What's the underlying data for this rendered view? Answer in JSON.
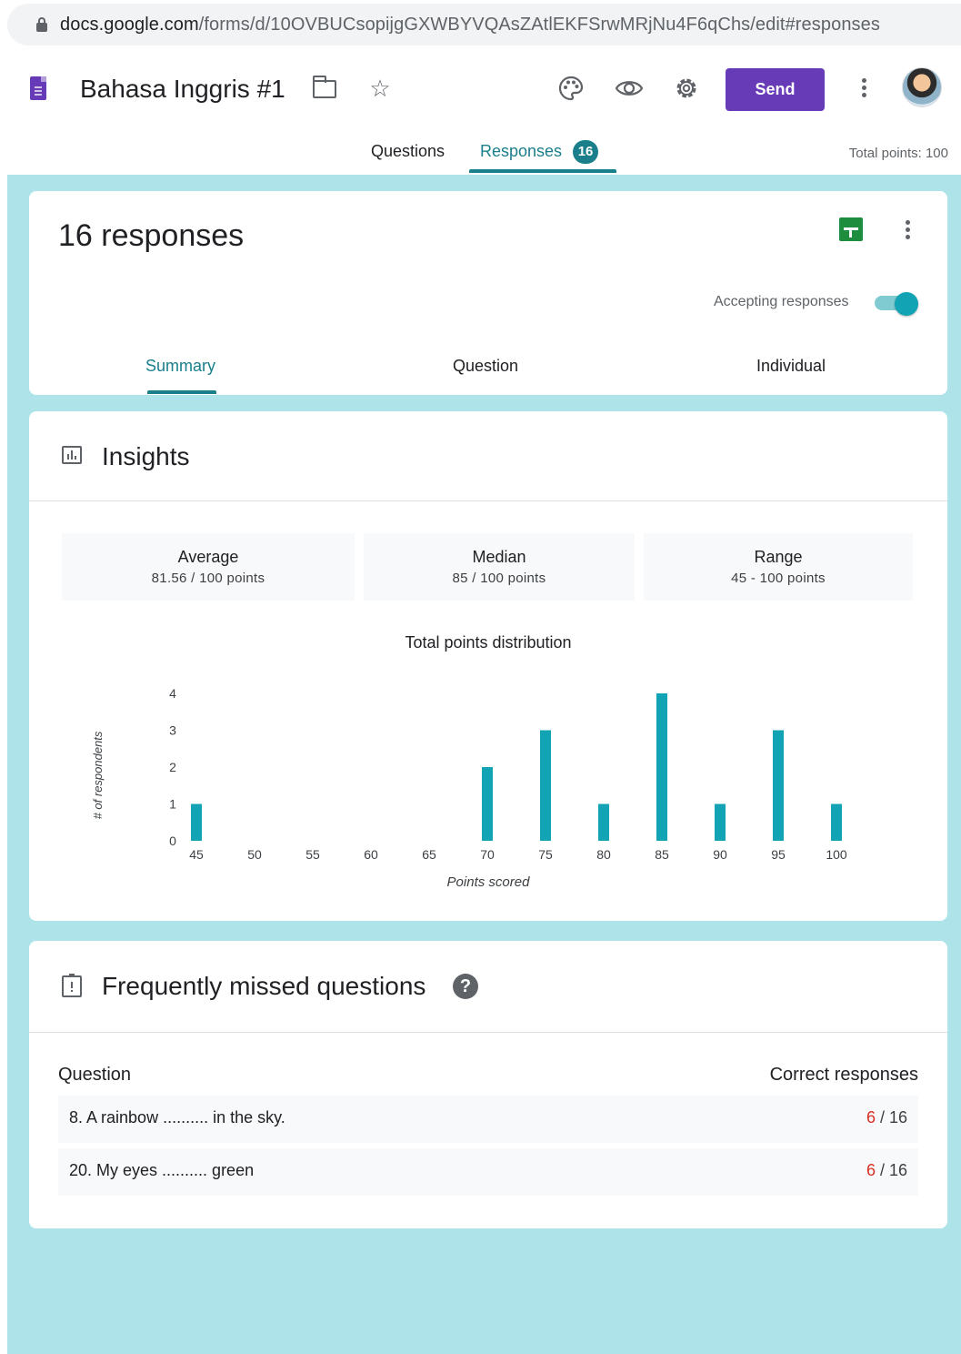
{
  "browser": {
    "url_host": "docs.google.com",
    "url_path": "/forms/d/10OVBUCsopijgGXWBYVQAsZAtlEKFSrwMRjNu4F6qChs/edit#responses"
  },
  "header": {
    "title": "Bahasa Inggris #1",
    "send_label": "Send",
    "tabs": [
      {
        "label": "Questions"
      },
      {
        "label": "Responses",
        "badge": "16"
      }
    ],
    "total_points": "Total points: 100"
  },
  "responses_card": {
    "count_label": "16 responses",
    "accepting_label": "Accepting responses",
    "accepting": true,
    "subtabs": [
      {
        "label": "Summary"
      },
      {
        "label": "Question"
      },
      {
        "label": "Individual"
      }
    ]
  },
  "insights": {
    "title": "Insights",
    "stats": [
      {
        "label": "Average",
        "value": "81.56 / 100 points"
      },
      {
        "label": "Median",
        "value": "85 / 100 points"
      },
      {
        "label": "Range",
        "value": "45 - 100 points"
      }
    ]
  },
  "chart_data": {
    "type": "bar",
    "title": "Total points distribution",
    "xlabel": "Points scored",
    "ylabel": "# of respondents",
    "categories": [
      "45",
      "50",
      "55",
      "60",
      "65",
      "70",
      "75",
      "80",
      "85",
      "90",
      "95",
      "100"
    ],
    "values": [
      1,
      0,
      0,
      0,
      0,
      2,
      3,
      1,
      4,
      1,
      3,
      1
    ],
    "yticks": [
      "0",
      "1",
      "2",
      "3",
      "4"
    ],
    "ylim": [
      0,
      4
    ],
    "bar_color": "#12a4b4",
    "grid": false
  },
  "missed": {
    "title": "Frequently missed questions",
    "col_question": "Question",
    "col_correct": "Correct responses",
    "rows": [
      {
        "question": "8. A rainbow .......... in the sky.",
        "correct": "6",
        "total": " / 16"
      },
      {
        "question": "20. My eyes .......... green",
        "correct": "6",
        "total": " / 16"
      }
    ]
  },
  "colors": {
    "accent": "#673ab7",
    "teal": "#1a7f8a",
    "background": "#aee3ea"
  }
}
